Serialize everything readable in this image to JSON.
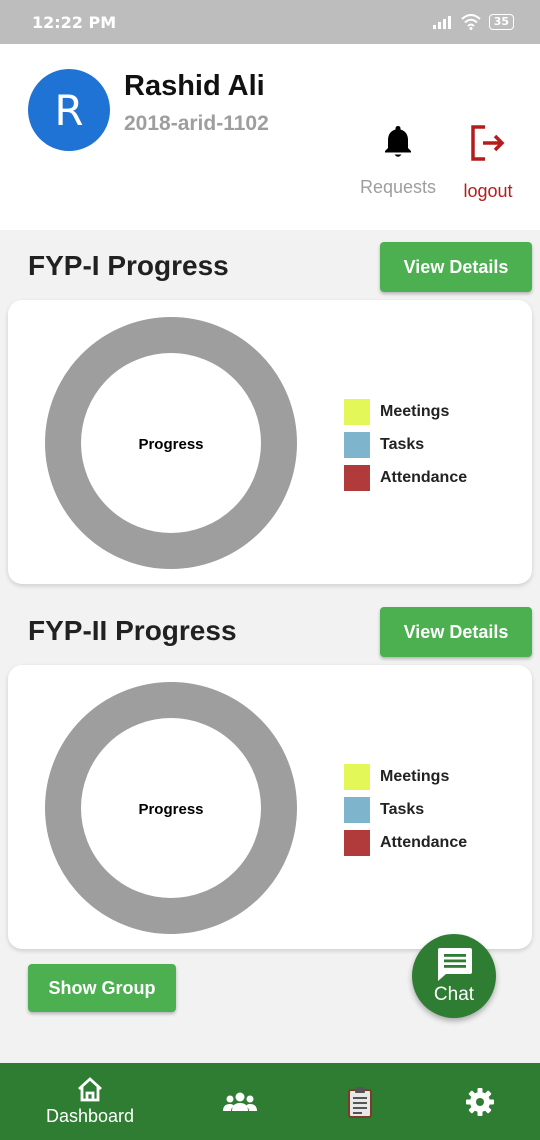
{
  "status_bar": {
    "time": "12:22 PM",
    "battery": "35"
  },
  "profile": {
    "avatar_initial": "R",
    "name": "Rashid Ali",
    "id": "2018-arid-1102"
  },
  "actions": {
    "requests_label": "Requests",
    "logout_label": "logout"
  },
  "fyp1": {
    "title": "FYP-I Progress",
    "view_label": "View Details",
    "center_label": "Progress",
    "legend": [
      {
        "label": "Meetings",
        "color": "#e4f759"
      },
      {
        "label": "Tasks",
        "color": "#7fb5cc"
      },
      {
        "label": "Attendance",
        "color": "#b13b3b"
      }
    ]
  },
  "fyp2": {
    "title": "FYP-II Progress",
    "view_label": "View Details",
    "center_label": "Progress",
    "legend": [
      {
        "label": "Meetings",
        "color": "#e4f759"
      },
      {
        "label": "Tasks",
        "color": "#7fb5cc"
      },
      {
        "label": "Attendance",
        "color": "#b13b3b"
      }
    ]
  },
  "show_group_label": "Show Group",
  "chat_label": "Chat",
  "bottom_nav": [
    {
      "icon": "home-icon",
      "label": "Dashboard"
    },
    {
      "icon": "group-icon",
      "label": ""
    },
    {
      "icon": "clipboard-icon",
      "label": ""
    },
    {
      "icon": "gear-icon",
      "label": ""
    }
  ],
  "colors": {
    "primary": "#4caf50",
    "dark_green": "#2e7d32",
    "avatar": "#1f73d4",
    "donut": "#9e9e9e",
    "logout": "#b71c1c"
  }
}
